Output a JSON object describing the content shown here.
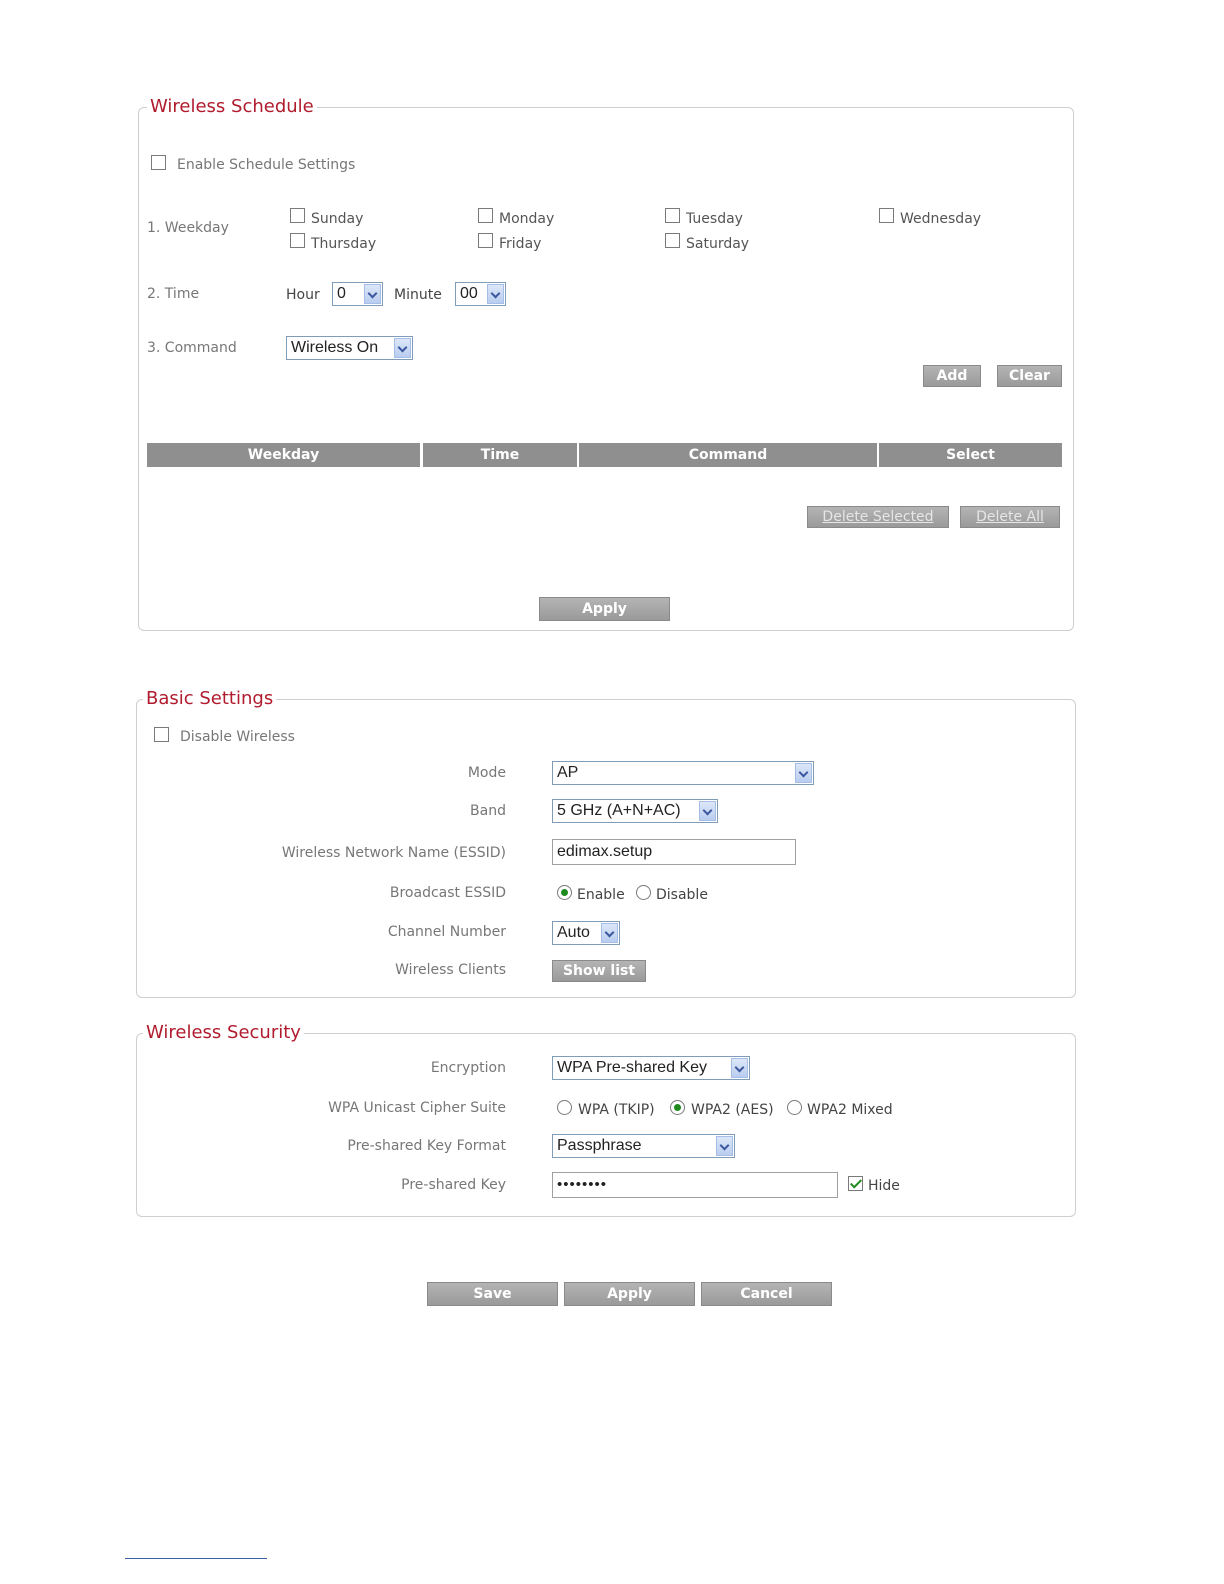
{
  "wireless_schedule": {
    "legend": "Wireless  Schedule",
    "enable_label": "Enable  Schedule Settings",
    "weekday_label": "1. Weekday",
    "days": [
      "Sunday",
      "Monday",
      "Tuesday",
      "Wednesday",
      "Thursday",
      "Friday",
      "Saturday"
    ],
    "time_label": "2. Time",
    "hour_label": "Hour",
    "hour_value": "0",
    "minute_label": "Minute",
    "minute_value": "00",
    "command_label": "3. Command",
    "command_value": "Wireless On",
    "add_label": "Add",
    "clear_label": "Clear",
    "table_headers": [
      "Weekday",
      "Time",
      "Command",
      "Select"
    ],
    "delete_selected_label": "Delete Selected",
    "delete_all_label": "Delete All",
    "apply_label": "Apply"
  },
  "basic_settings": {
    "legend": "Basic Settings",
    "disable_label": "Disable  Wireless",
    "mode_label": "Mode",
    "mode_value": "AP",
    "band_label": "Band",
    "band_value": "5 GHz (A+N+AC)",
    "essid_label": "Wireless Network Name  (ESSID)",
    "essid_value": "edimax.setup",
    "broadcast_label": "Broadcast ESSID",
    "broadcast_enable": "Enable",
    "broadcast_disable": "Disable",
    "channel_label": "Channel Number",
    "channel_value": "Auto",
    "clients_label": "Wireless Clients",
    "show_list_label": "Show list"
  },
  "wireless_security": {
    "legend": "Wireless  Security",
    "encryption_label": "Encryption",
    "encryption_value": "WPA Pre-shared Key",
    "cipher_label": "WPA Unicast Cipher Suite",
    "cipher_tkip": "WPA (TKIP)",
    "cipher_aes": "WPA2 (AES)",
    "cipher_mixed": "WPA2 Mixed",
    "key_format_label": "Pre-shared Key Format",
    "key_format_value": "Passphrase",
    "key_label": "Pre-shared Key",
    "key_value": "••••••••",
    "hide_label": "Hide"
  },
  "footer": {
    "save_label": "Save",
    "apply_label": "Apply",
    "cancel_label": "Cancel"
  }
}
